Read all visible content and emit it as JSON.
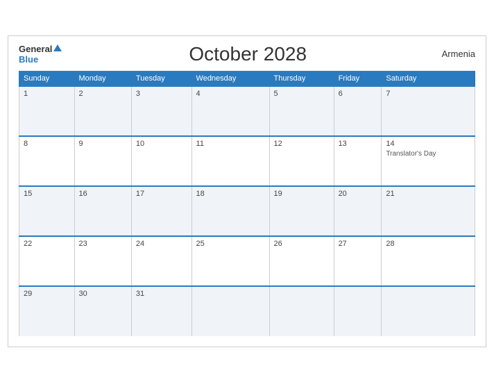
{
  "header": {
    "logo_general": "General",
    "logo_blue": "Blue",
    "title": "October 2028",
    "country": "Armenia"
  },
  "days_of_week": [
    "Sunday",
    "Monday",
    "Tuesday",
    "Wednesday",
    "Thursday",
    "Friday",
    "Saturday"
  ],
  "weeks": [
    [
      {
        "day": "1",
        "event": ""
      },
      {
        "day": "2",
        "event": ""
      },
      {
        "day": "3",
        "event": ""
      },
      {
        "day": "4",
        "event": ""
      },
      {
        "day": "5",
        "event": ""
      },
      {
        "day": "6",
        "event": ""
      },
      {
        "day": "7",
        "event": ""
      }
    ],
    [
      {
        "day": "8",
        "event": ""
      },
      {
        "day": "9",
        "event": ""
      },
      {
        "day": "10",
        "event": ""
      },
      {
        "day": "11",
        "event": ""
      },
      {
        "day": "12",
        "event": ""
      },
      {
        "day": "13",
        "event": ""
      },
      {
        "day": "14",
        "event": "Translator's Day"
      }
    ],
    [
      {
        "day": "15",
        "event": ""
      },
      {
        "day": "16",
        "event": ""
      },
      {
        "day": "17",
        "event": ""
      },
      {
        "day": "18",
        "event": ""
      },
      {
        "day": "19",
        "event": ""
      },
      {
        "day": "20",
        "event": ""
      },
      {
        "day": "21",
        "event": ""
      }
    ],
    [
      {
        "day": "22",
        "event": ""
      },
      {
        "day": "23",
        "event": ""
      },
      {
        "day": "24",
        "event": ""
      },
      {
        "day": "25",
        "event": ""
      },
      {
        "day": "26",
        "event": ""
      },
      {
        "day": "27",
        "event": ""
      },
      {
        "day": "28",
        "event": ""
      }
    ],
    [
      {
        "day": "29",
        "event": ""
      },
      {
        "day": "30",
        "event": ""
      },
      {
        "day": "31",
        "event": ""
      },
      {
        "day": "",
        "event": ""
      },
      {
        "day": "",
        "event": ""
      },
      {
        "day": "",
        "event": ""
      },
      {
        "day": "",
        "event": ""
      }
    ]
  ]
}
